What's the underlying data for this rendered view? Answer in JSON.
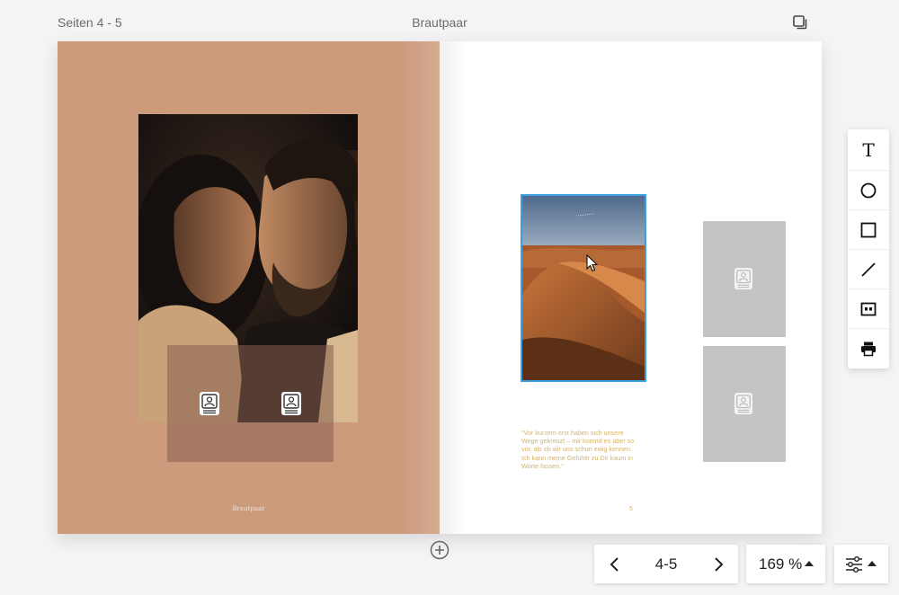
{
  "header": {
    "pages_label": "Seiten 4 - 5",
    "title": "Brautpaar",
    "copy_icon": "copy-icon"
  },
  "left_page": {
    "footer_text": "Brautpaar"
  },
  "right_page": {
    "quote": "\"Vor kurzem erst haben sich unsere Wege gekreuzt – mir kommt es aber so vor, als ob wir uns schon ewig kennen. Ich kann meine Gefühle zu Dir kaum in Worte fassen.\"",
    "page_number": "5"
  },
  "toolbox": {
    "items": [
      "text-tool-icon",
      "circle-tool-icon",
      "rectangle-tool-icon",
      "line-tool-icon",
      "frame-tool-icon",
      "print-icon"
    ],
    "text_glyph": "T"
  },
  "pager": {
    "value": "4-5"
  },
  "zoom": {
    "value": "169 %"
  },
  "colors": {
    "left_page_bg": "#cc9b7c",
    "selection": "#3aa0e0",
    "quote_text": "#d4b36a",
    "placeholder": "#c4c3c6"
  }
}
